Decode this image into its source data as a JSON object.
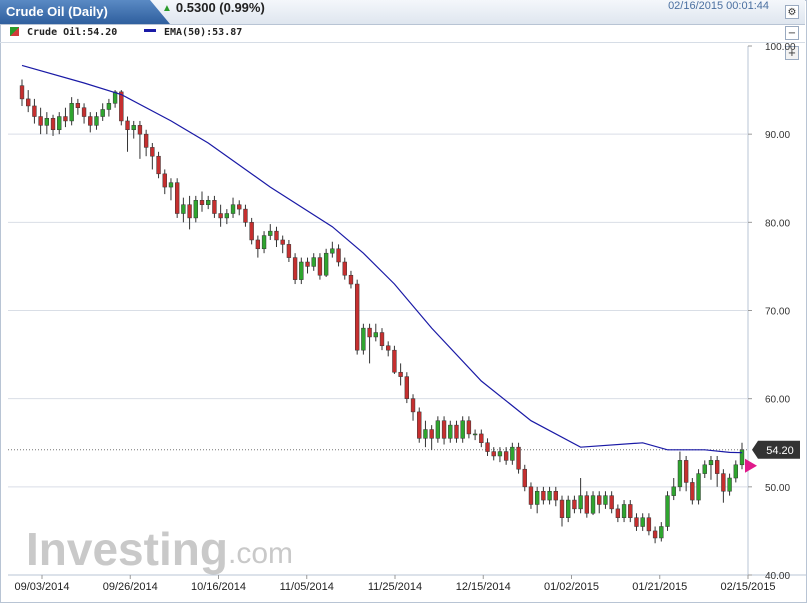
{
  "header": {
    "title": "Crude Oil (Daily)",
    "change": "0.5300 (0.99%)",
    "timestamp": "02/16/2015 00:01:44",
    "up_color": "#2a9b2a"
  },
  "legend": {
    "instrument": "Crude Oil:54.20",
    "ema": "EMA(50):53.87"
  },
  "watermark": {
    "brand": "Investing",
    "suffix": ".com"
  },
  "chart_data": {
    "type": "candlestick",
    "title": "Crude Oil (Daily)",
    "ylim": [
      40,
      100
    ],
    "yticks": [
      "100.00",
      "90.00",
      "80.00",
      "70.00",
      "60.00",
      "50.00",
      "40.00"
    ],
    "x_tick_labels": [
      "09/03/2014",
      "09/26/2014",
      "10/16/2014",
      "11/05/2014",
      "11/25/2014",
      "12/15/2014",
      "01/02/2015",
      "01/21/2015",
      "02/15/2015"
    ],
    "last_price_label": "54.20",
    "last_price": 54.2,
    "grid": true,
    "colors": {
      "up": "#2fa52f",
      "down": "#c62f2f",
      "ema": "#1a1aa6",
      "marker": "#e0198a"
    },
    "candles": [
      [
        95.5,
        94.0,
        96.2,
        93.2
      ],
      [
        94.0,
        93.2,
        95.0,
        92.5
      ],
      [
        93.2,
        92.0,
        94.0,
        91.2
      ],
      [
        92.0,
        91.0,
        93.0,
        90.0
      ],
      [
        91.0,
        91.8,
        92.5,
        90.0
      ],
      [
        91.8,
        90.5,
        92.2,
        89.8
      ],
      [
        90.5,
        92.0,
        92.5,
        90.0
      ],
      [
        92.0,
        91.5,
        93.0,
        90.8
      ],
      [
        91.5,
        93.5,
        94.2,
        91.0
      ],
      [
        93.5,
        93.0,
        94.0,
        92.2
      ],
      [
        93.0,
        92.0,
        93.5,
        91.2
      ],
      [
        92.0,
        91.0,
        92.5,
        90.2
      ],
      [
        91.0,
        92.0,
        92.5,
        90.5
      ],
      [
        92.0,
        92.8,
        93.5,
        91.5
      ],
      [
        92.8,
        93.5,
        94.0,
        92.0
      ],
      [
        93.5,
        94.8,
        95.0,
        93.0
      ],
      [
        94.8,
        91.5,
        95.0,
        91.0
      ],
      [
        91.5,
        90.5,
        92.0,
        88.0
      ],
      [
        90.5,
        91.0,
        91.5,
        89.5
      ],
      [
        91.0,
        90.0,
        91.5,
        87.2
      ],
      [
        90.0,
        88.5,
        90.5,
        87.5
      ],
      [
        88.5,
        87.5,
        89.0,
        86.0
      ],
      [
        87.5,
        85.5,
        88.0,
        85.0
      ],
      [
        85.5,
        84.0,
        86.0,
        83.2
      ],
      [
        84.0,
        84.5,
        85.0,
        82.5
      ],
      [
        84.5,
        81.0,
        85.0,
        80.5
      ],
      [
        81.0,
        82.0,
        82.8,
        80.0
      ],
      [
        82.0,
        80.5,
        83.0,
        79.2
      ],
      [
        80.5,
        82.5,
        83.0,
        80.0
      ],
      [
        82.5,
        82.0,
        83.5,
        81.2
      ],
      [
        82.0,
        82.5,
        83.0,
        81.5
      ],
      [
        82.5,
        81.0,
        83.0,
        80.5
      ],
      [
        81.0,
        80.5,
        82.0,
        79.5
      ],
      [
        80.5,
        81.0,
        81.5,
        79.8
      ],
      [
        81.0,
        82.0,
        82.8,
        80.5
      ],
      [
        82.0,
        81.5,
        82.5,
        80.8
      ],
      [
        81.5,
        80.0,
        82.0,
        79.5
      ],
      [
        80.0,
        78.0,
        80.5,
        77.5
      ],
      [
        78.0,
        77.0,
        78.5,
        76.0
      ],
      [
        77.0,
        78.5,
        79.0,
        76.5
      ],
      [
        78.5,
        79.0,
        79.8,
        78.0
      ],
      [
        79.0,
        78.0,
        79.5,
        77.2
      ],
      [
        78.0,
        77.5,
        78.5,
        76.5
      ],
      [
        77.5,
        76.0,
        78.0,
        75.5
      ],
      [
        76.0,
        73.5,
        76.5,
        73.0
      ],
      [
        73.5,
        75.5,
        76.0,
        73.0
      ],
      [
        75.5,
        75.0,
        76.0,
        74.2
      ],
      [
        75.0,
        76.0,
        76.5,
        74.5
      ],
      [
        76.0,
        74.0,
        76.5,
        73.5
      ],
      [
        74.0,
        76.5,
        77.0,
        73.8
      ],
      [
        76.5,
        77.0,
        77.8,
        76.0
      ],
      [
        77.0,
        75.5,
        77.5,
        75.0
      ],
      [
        75.5,
        74.0,
        76.0,
        73.5
      ],
      [
        74.0,
        73.0,
        74.5,
        72.5
      ],
      [
        73.0,
        65.5,
        73.5,
        65.0
      ],
      [
        65.5,
        68.0,
        68.5,
        65.0
      ],
      [
        68.0,
        67.0,
        68.5,
        64.0
      ],
      [
        67.0,
        67.5,
        68.5,
        66.5
      ],
      [
        67.5,
        66.0,
        68.0,
        65.5
      ],
      [
        66.0,
        65.5,
        66.5,
        64.8
      ],
      [
        65.5,
        63.0,
        66.0,
        62.8
      ],
      [
        63.0,
        62.5,
        64.0,
        61.5
      ],
      [
        62.5,
        60.0,
        63.0,
        59.5
      ],
      [
        60.0,
        58.5,
        60.5,
        57.5
      ],
      [
        58.5,
        55.5,
        59.0,
        55.0
      ],
      [
        55.5,
        56.5,
        57.5,
        54.5
      ],
      [
        56.5,
        55.5,
        57.0,
        54.2
      ],
      [
        55.5,
        57.5,
        58.0,
        55.0
      ],
      [
        57.5,
        55.5,
        58.0,
        54.8
      ],
      [
        55.5,
        57.0,
        57.5,
        55.0
      ],
      [
        57.0,
        55.5,
        57.5,
        55.0
      ],
      [
        55.5,
        57.5,
        58.0,
        55.0
      ],
      [
        57.5,
        56.0,
        58.0,
        55.5
      ],
      [
        56.0,
        56.0,
        56.5,
        55.3
      ],
      [
        56.0,
        55.0,
        56.5,
        54.5
      ],
      [
        55.0,
        54.0,
        55.5,
        53.5
      ],
      [
        54.0,
        53.5,
        54.5,
        53.0
      ],
      [
        53.5,
        54.0,
        54.5,
        52.8
      ],
      [
        54.0,
        53.0,
        54.5,
        52.5
      ],
      [
        53.0,
        54.5,
        55.0,
        52.5
      ],
      [
        54.5,
        52.0,
        55.0,
        51.5
      ],
      [
        52.0,
        50.0,
        52.5,
        49.5
      ],
      [
        50.0,
        48.0,
        50.5,
        47.5
      ],
      [
        48.0,
        49.5,
        50.0,
        47.0
      ],
      [
        49.5,
        48.5,
        50.0,
        48.0
      ],
      [
        48.5,
        49.5,
        50.0,
        48.0
      ],
      [
        49.5,
        48.5,
        50.0,
        47.8
      ],
      [
        48.5,
        46.5,
        49.0,
        45.5
      ],
      [
        46.5,
        48.5,
        49.0,
        46.0
      ],
      [
        48.5,
        47.5,
        49.0,
        47.0
      ],
      [
        47.5,
        49.0,
        51.0,
        47.0
      ],
      [
        49.0,
        47.0,
        49.5,
        46.5
      ],
      [
        47.0,
        49.0,
        49.5,
        46.8
      ],
      [
        49.0,
        48.0,
        49.5,
        47.0
      ],
      [
        48.0,
        49.0,
        49.5,
        47.5
      ],
      [
        49.0,
        47.5,
        49.5,
        47.0
      ],
      [
        47.5,
        46.5,
        48.0,
        46.0
      ],
      [
        46.5,
        48.0,
        48.5,
        46.0
      ],
      [
        48.0,
        46.5,
        48.5,
        46.0
      ],
      [
        46.5,
        45.5,
        47.0,
        45.0
      ],
      [
        45.5,
        46.5,
        47.0,
        45.0
      ],
      [
        46.5,
        45.0,
        47.0,
        44.5
      ],
      [
        45.0,
        44.2,
        45.5,
        43.6
      ],
      [
        44.2,
        45.5,
        46.0,
        43.8
      ],
      [
        45.5,
        49.0,
        49.5,
        45.0
      ],
      [
        49.0,
        50.0,
        51.0,
        48.5
      ],
      [
        50.0,
        53.0,
        54.0,
        49.5
      ],
      [
        53.0,
        50.5,
        53.5,
        49.5
      ],
      [
        50.5,
        48.5,
        51.0,
        48.0
      ],
      [
        48.5,
        51.5,
        52.0,
        48.0
      ],
      [
        51.5,
        52.5,
        53.0,
        51.0
      ],
      [
        52.5,
        53.0,
        53.5,
        50.8
      ],
      [
        53.0,
        51.5,
        53.5,
        50.0
      ],
      [
        51.5,
        49.5,
        52.0,
        48.2
      ],
      [
        49.5,
        51.0,
        51.5,
        49.0
      ],
      [
        51.0,
        52.5,
        53.0,
        50.5
      ],
      [
        52.5,
        54.2,
        55.0,
        52.0
      ]
    ],
    "ema": [
      [
        0,
        97.8
      ],
      [
        10,
        95.8
      ],
      [
        16,
        94.5
      ],
      [
        24,
        91.5
      ],
      [
        30,
        89.0
      ],
      [
        40,
        84.0
      ],
      [
        50,
        79.5
      ],
      [
        55,
        76.5
      ],
      [
        60,
        73.0
      ],
      [
        66,
        68.0
      ],
      [
        74,
        62.0
      ],
      [
        82,
        57.5
      ],
      [
        90,
        54.5
      ],
      [
        100,
        55.0
      ],
      [
        104,
        54.2
      ],
      [
        110,
        54.2
      ],
      [
        114,
        53.9
      ],
      [
        116,
        53.87
      ]
    ]
  }
}
